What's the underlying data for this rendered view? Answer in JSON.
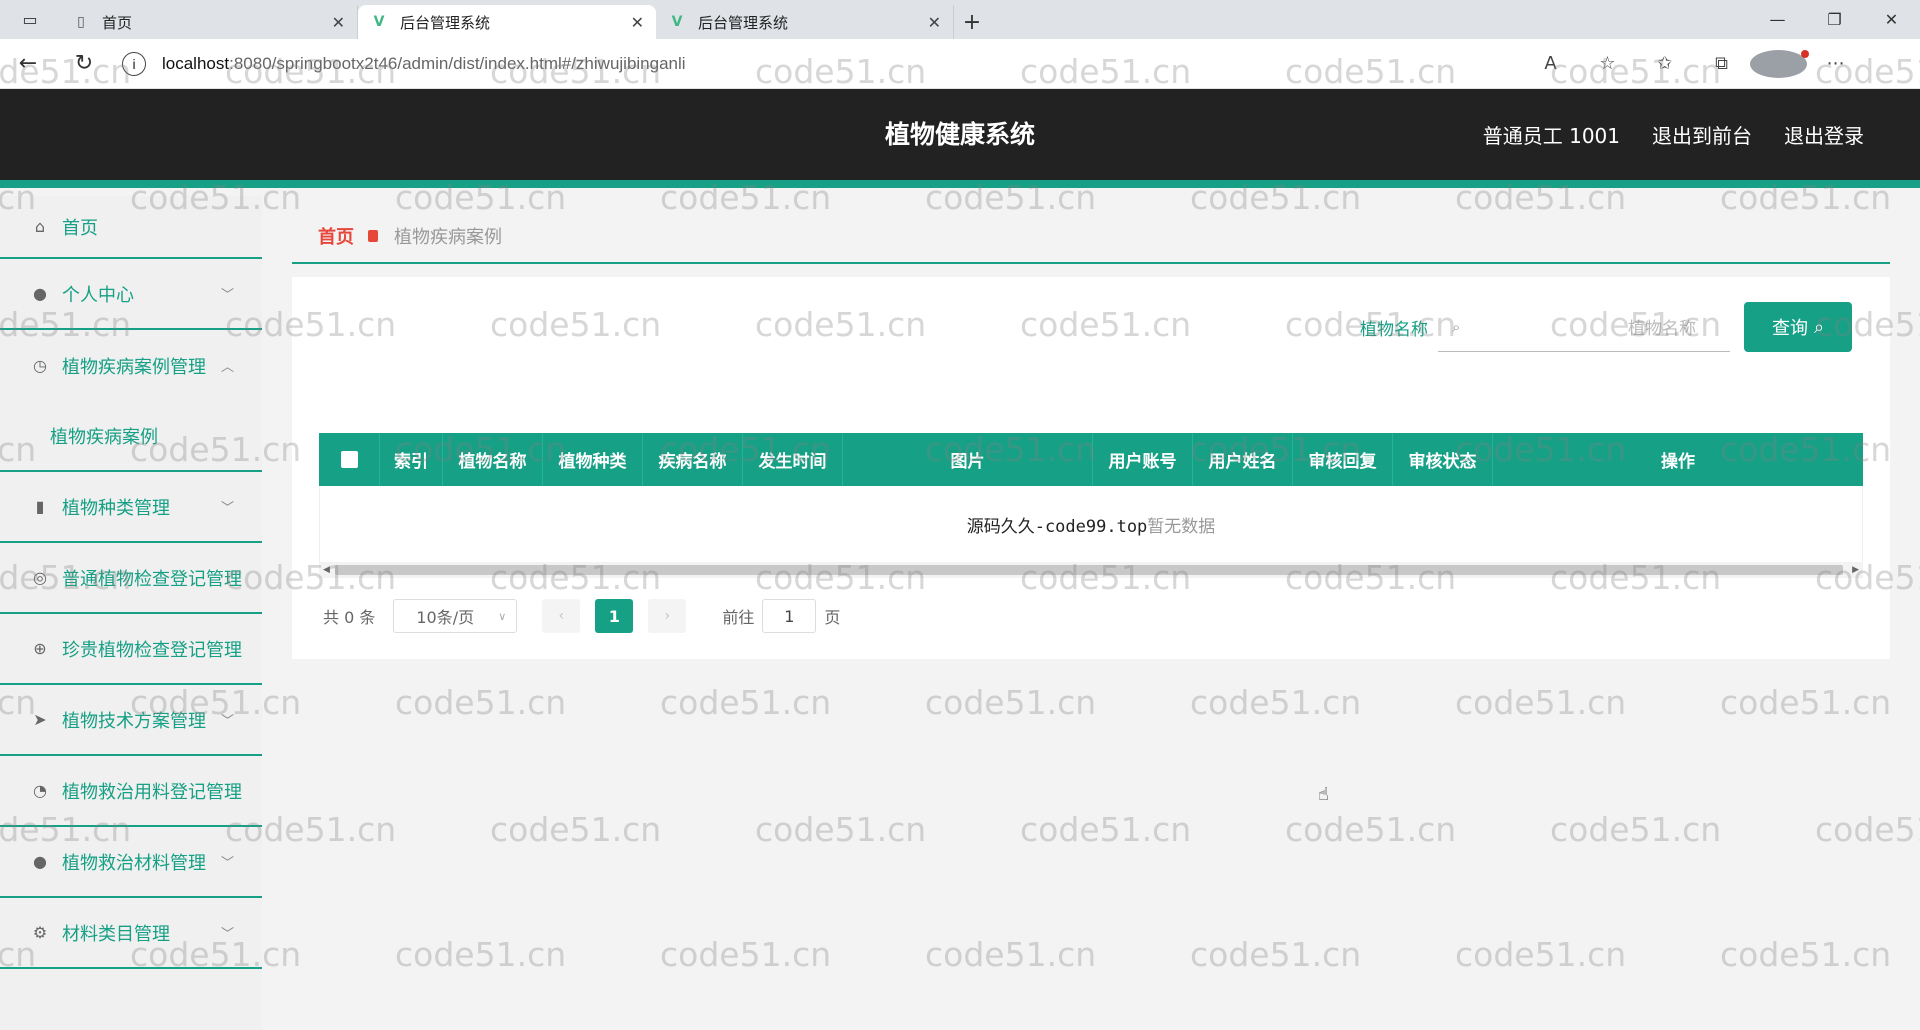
{
  "browser": {
    "tabs": [
      {
        "title": "首页",
        "icon": "page-icon"
      },
      {
        "title": "后台管理系统",
        "icon": "vue-icon"
      },
      {
        "title": "后台管理系统",
        "icon": "vue-icon"
      }
    ],
    "url_host": "localhost",
    "url_path": ":8080/springbootx2t46/admin/dist/index.html#/zhiwujibinganli"
  },
  "header": {
    "title": "植物健康系统",
    "user": "普通员工 1001",
    "to_front": "退出到前台",
    "logout": "退出登录"
  },
  "sidebar": {
    "items": [
      {
        "label": "首页",
        "icon": "home-icon"
      },
      {
        "label": "个人中心",
        "icon": "user-icon",
        "expandable": true
      },
      {
        "label": "植物疾病案例管理",
        "icon": "clock-icon",
        "expanded": true
      },
      {
        "label": "植物疾病案例",
        "submenu": true
      },
      {
        "label": "植物种类管理",
        "icon": "bar-chart-icon",
        "expandable": true
      },
      {
        "label": "普通植物检查登记管理",
        "icon": "compass-icon"
      },
      {
        "label": "珍贵植物检查登记管理",
        "icon": "target-icon"
      },
      {
        "label": "植物技术方案管理",
        "icon": "send-icon",
        "expandable": true
      },
      {
        "label": "植物救治用料登记管理",
        "icon": "gauge-icon"
      },
      {
        "label": "植物救治材料管理",
        "icon": "bulb-icon",
        "expandable": true
      },
      {
        "label": "材料类目管理",
        "icon": "settings-icon",
        "expandable": true
      }
    ]
  },
  "breadcrumb": {
    "home": "首页",
    "current": "植物疾病案例"
  },
  "search": {
    "label": "植物名称",
    "placeholder": "植物名称",
    "button": "查询"
  },
  "table": {
    "columns": [
      "索引",
      "植物名称",
      "植物种类",
      "疾病名称",
      "发生时间",
      "图片",
      "用户账号",
      "用户姓名",
      "审核回复",
      "审核状态",
      "操作"
    ],
    "empty_watermark": "源码久久-code99.top",
    "empty_text": "暂无数据"
  },
  "pagination": {
    "total": "共 0 条",
    "page_size": "10条/页",
    "current_page": "1",
    "goto_label": "前往",
    "goto_value": "1",
    "goto_suffix": "页"
  },
  "watermark_text": "code51.cn",
  "colors": {
    "accent": "#16a085",
    "header_bg": "#222222",
    "breadcrumb_home": "#e6473a"
  }
}
